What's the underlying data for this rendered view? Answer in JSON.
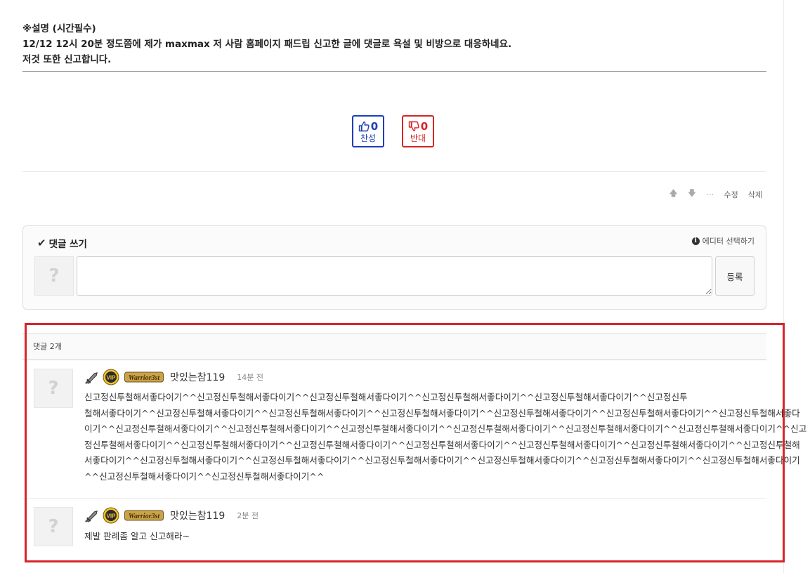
{
  "post": {
    "desc_line1": "※설명 (시간필수)",
    "desc_line2": "12/12  12시 20분 정도쯤에 제가 maxmax 저 사람 홈페이지 패드립 신고한 글에 댓글로 욕설 및 비방으로 대응하네요.",
    "desc_line3": "저것 또한 신고합니다."
  },
  "votes": {
    "up": {
      "count": "0",
      "label": "찬성"
    },
    "down": {
      "count": "0",
      "label": "반대"
    },
    "colors": {
      "up": "#1f3fb5",
      "down": "#d62525"
    }
  },
  "actions": {
    "edit": "수정",
    "delete": "삭제",
    "up_icon": "arrow-up-icon",
    "down_icon": "arrow-down-icon",
    "more_icon": "ellipsis-icon"
  },
  "comment_form": {
    "title": "댓글 쓰기",
    "editor_select": "에디터 선택하기",
    "submit": "등록",
    "avatar_placeholder": "?",
    "textarea_value": ""
  },
  "comments": {
    "count_label": "댓글 2개",
    "items": [
      {
        "avatar": "?",
        "badge": "Warrior3st",
        "nickname": "맛있는참119",
        "time": "14분 전",
        "lines": [
          "신고정신투철해서좋다이기^^신고정신투철해서좋다이기^^신고정신투철해서좋다이기^^신고정신투철해서좋다이기^^신고정신투철해서좋다이기^^신고정신투",
          "철해서좋다이기^^신고정신투철해서좋다이기^^신고정신투철해서좋다이기^^신고정신투철해서좋다이기^^신고정신투철해서좋다이기^^신고정신투철해서좋다이기^^신고정신투철해서좋다",
          "이기^^신고정신투철해서좋다이기^^신고정신투철해서좋다이기^^신고정신투철해서좋다이기^^신고정신투철해서좋다이기^^신고정신투철해서좋다이기^^신고정신투철해서좋다이기^^신고",
          "정신투철해서좋다이기^^신고정신투철해서좋다이기^^신고정신투철해서좋다이기^^신고정신투철해서좋다이기^^신고정신투철해서좋다이기^^신고정신투철해서좋다이기^^신고정신투철해",
          "서좋다이기^^신고정신투철해서좋다이기^^신고정신투철해서좋다이기^^신고정신투철해서좋다이기^^신고정신투철해서좋다이기^^신고정신투철해서좋다이기^^신고정신투철해서좋다이기",
          "^^신고정신투철해서좋다이기^^신고정신투철해서좋다이기^^"
        ]
      },
      {
        "avatar": "?",
        "badge": "Warrior3st",
        "nickname": "맛있는참119",
        "time": "2분 전",
        "lines": [
          "제발 판례좀 알고 신고해라~"
        ]
      }
    ]
  },
  "highlight_color": "#d8232a"
}
